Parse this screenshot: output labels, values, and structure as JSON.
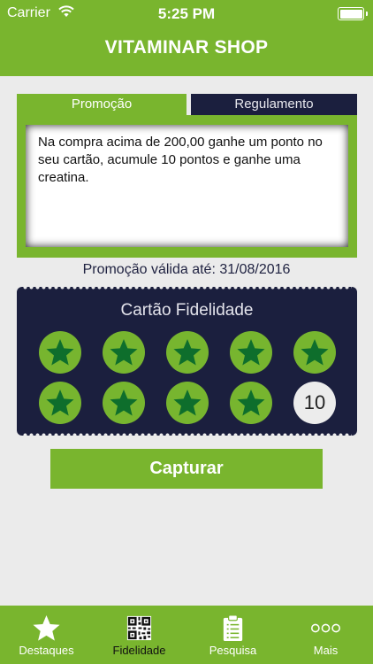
{
  "status_bar": {
    "carrier": "Carrier",
    "time": "5:25 PM"
  },
  "header": {
    "title": "VITAMINAR SHOP"
  },
  "tabs": [
    {
      "label": "Promoção",
      "active": true
    },
    {
      "label": "Regulamento",
      "active": false
    }
  ],
  "promotion": {
    "text": "Na compra acima de 200,00 ganhe um ponto no seu cartão, acumule 10 pontos e ganhe uma creatina.",
    "validity": "Promoção válida até: 31/08/2016"
  },
  "card": {
    "title": "Cartão Fidelidade",
    "stamps_collected": 9,
    "stamps_total": 10,
    "final_stamp_label": "10"
  },
  "actions": {
    "capture_label": "Capturar"
  },
  "tab_bar": [
    {
      "label": "Destaques",
      "icon": "star-icon",
      "active": false
    },
    {
      "label": "Fidelidade",
      "icon": "qr-code-icon",
      "active": true
    },
    {
      "label": "Pesquisa",
      "icon": "clipboard-icon",
      "active": false
    },
    {
      "label": "Mais",
      "icon": "more-icon",
      "active": false
    }
  ],
  "colors": {
    "brand_green": "#79b52e",
    "navy": "#1b1f3e",
    "stamp_star": "#0e6e2c",
    "background": "#ebebeb"
  }
}
